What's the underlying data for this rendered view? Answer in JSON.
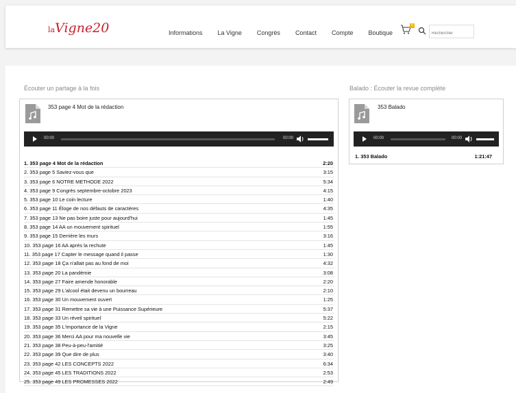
{
  "brand": {
    "prefix": "la",
    "name": "Vigne20"
  },
  "nav": [
    "Informations",
    "La Vigne",
    "Congrès",
    "Contact",
    "Compte",
    "Boutique"
  ],
  "cart": {
    "count": "0"
  },
  "search": {
    "placeholder": "Rechercher"
  },
  "left": {
    "title": "Écouter un partage à la fois",
    "current_track": "353 page 4 Mot de la rédaction",
    "player": {
      "elapsed": "00:00",
      "total": "00:00"
    },
    "tracks": [
      {
        "title": "1. 353 page 4 Mot de la rédaction",
        "duration": "2:20"
      },
      {
        "title": "2. 353 page 5 Saviez-vous que",
        "duration": "3:15"
      },
      {
        "title": "3. 353 page 6 NOTRE METHODE 2022",
        "duration": "5:34"
      },
      {
        "title": "4. 353 page 9 Congrès septembre-octobre 2023",
        "duration": "4:15"
      },
      {
        "title": "5. 353 page 10 Le coin lecture",
        "duration": "1:40"
      },
      {
        "title": "6. 353 page 11 Éloge de nos défauts de caractères",
        "duration": "4:35"
      },
      {
        "title": "7. 353 page 13 Ne pas boire juste pour aujourd'hui",
        "duration": "1:45"
      },
      {
        "title": "8. 353 page 14 AA un mouvement spirituel",
        "duration": "1:55"
      },
      {
        "title": "9. 353 page 15 Derrière les murs",
        "duration": "3:16"
      },
      {
        "title": "10. 353 page 16 AA après la rechute",
        "duration": "1:45"
      },
      {
        "title": "11. 353 page 17 Capter le message quand il passe",
        "duration": "1:30"
      },
      {
        "title": "12. 353 page 18 Ça n'allait pas au fond de moi",
        "duration": "4:32"
      },
      {
        "title": "13. 353 page 20 La pandémie",
        "duration": "3:08"
      },
      {
        "title": "14. 353 page 27 Faire amende honorable",
        "duration": "2:20"
      },
      {
        "title": "15. 353 page 29 L'alcool était devenu un bourreau",
        "duration": "2:10"
      },
      {
        "title": "16. 353 page 30 Un mouvement ouvert",
        "duration": "1:25"
      },
      {
        "title": "17. 353 page 31 Remettre sa vie à une Puissance Supérieure",
        "duration": "5:37"
      },
      {
        "title": "18. 353 page 33 Un réveil spirituel",
        "duration": "5:22"
      },
      {
        "title": "19. 353 page 35 L'importance de la Vigne",
        "duration": "2:15"
      },
      {
        "title": "20. 353 page 36 Merci AA pour ma nouvelle vie",
        "duration": "3:45"
      },
      {
        "title": "21. 353 page 38 Peu-à-peu-l'amitié",
        "duration": "3:25"
      },
      {
        "title": "22. 353 page 39 Que dire de plus",
        "duration": "3:40"
      },
      {
        "title": "23. 353 page 42 LES CONCEPTS 2022",
        "duration": "6:34"
      },
      {
        "title": "24. 353 page 45 LES TRADITIONS 2022",
        "duration": "2:53"
      },
      {
        "title": "25. 353 page 49 LES PROMESSES 2022",
        "duration": "2:49"
      }
    ]
  },
  "right": {
    "title": "Balado : Écouter la revue complète",
    "current_track": "353 Balado",
    "player": {
      "elapsed": "00:00",
      "total": "00:00"
    },
    "tracks": [
      {
        "title": "1. 353 Balado",
        "duration": "1:21:47"
      }
    ]
  }
}
